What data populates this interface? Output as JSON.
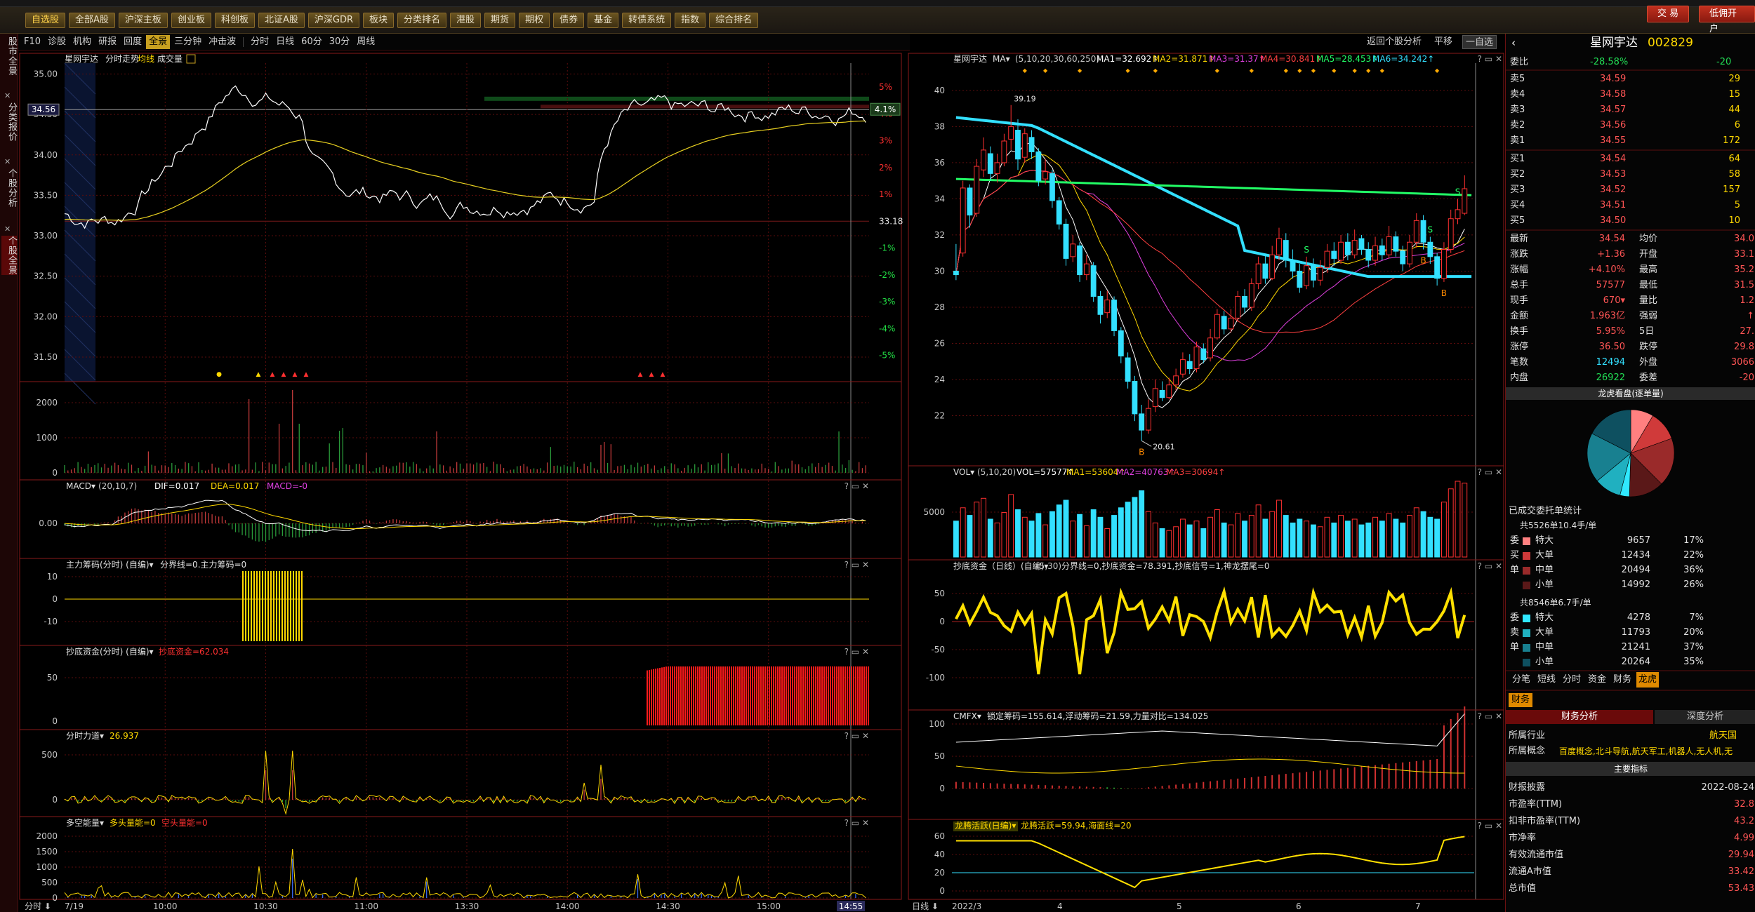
{
  "window": {
    "title": "星网宇达 002829"
  },
  "toolbar": {
    "buttons": [
      "自选股",
      "全部A股",
      "沪深主板",
      "创业板",
      "科创板",
      "北证A股",
      "沪深GDR",
      "板块",
      "分类排名",
      "港股",
      "期货",
      "期权",
      "债券",
      "基金",
      "转债系统",
      "指数",
      "综合排名"
    ],
    "trade_label": "交 易",
    "open_account_label": "低佣开户"
  },
  "sidebar": {
    "tabs": [
      "股市全景",
      "分类报价",
      "个股分析",
      "个股全景"
    ]
  },
  "subbar": {
    "items": [
      "F10",
      "诊股",
      "机构",
      "研报",
      "回度",
      "全景",
      "三分钟",
      "冲击波",
      "分时",
      "日线",
      "60分",
      "30分",
      "周线"
    ],
    "active": "全景"
  },
  "midbar": {
    "items": [
      "返回个股分析",
      "平移",
      "一自选"
    ]
  },
  "intraday": {
    "title": "星网宇达",
    "subtitle": "分时走势",
    "ma_label": "均线",
    "vol_label": "成交量",
    "price_axis": [
      "35.00",
      "34.50",
      "34.00",
      "33.50",
      "33.00",
      "32.50",
      "32.00",
      "31.50"
    ],
    "pct_axis": [
      "5%",
      "4%",
      "3%",
      "2%",
      "1%",
      "-1%",
      "-2%",
      "-3%",
      "-4%",
      "-5%"
    ],
    "prev_close": "33.18",
    "cur_price": "34.56",
    "cur_pct": "4.1%",
    "vol_axis": [
      "2000",
      "1000",
      "0"
    ],
    "time_labels": [
      "7/19",
      "10:00",
      "10:30",
      "11:00",
      "13:30",
      "14:00",
      "14:30",
      "15:00"
    ],
    "time_cur": "14:55",
    "x_label": "分时",
    "macd_title": "MACD",
    "macd_params": "(20,10,7)",
    "macd_dif": "DIF=0.017",
    "macd_dea": "DEA=0.017",
    "macd_val": "MACD=-0",
    "macd_axis": [
      "0.00"
    ],
    "zlcm_title": "主力筹码(分时)",
    "zlcm_text": "分界线=0.主力筹码=0",
    "zlcm_axis": [
      "10",
      "0",
      "-10"
    ],
    "cdzj_title": "抄底资金(分时)",
    "cdzj_text": "抄底资金=62.034",
    "cdzj_axis": [
      "50",
      "0"
    ],
    "fsld_title": "分时力道",
    "fsld_text": "26.937",
    "fsld_axis": [
      "500",
      "0"
    ],
    "dkn_title": "多空能量",
    "dkn_text1": "多头量能=0",
    "dkn_text2": "空头量能=0",
    "dkn_axis": [
      "2000",
      "1500",
      "1000",
      "500",
      "0"
    ],
    "panel_ctrl": "? ▭ ✕"
  },
  "daily": {
    "title": "星网宇达",
    "ma_label": "MA",
    "ma_params": "(5,10,20,30,60,250)",
    "ma_values": [
      "MA1=32.692",
      "MA2=31.871",
      "MA3=31.37",
      "MA4=30.841",
      "MA5=28.453",
      "MA6=34.242"
    ],
    "price_axis": [
      "40",
      "38",
      "36",
      "34",
      "32",
      "30",
      "28",
      "26",
      "24",
      "22"
    ],
    "high_mark": "39.19",
    "low_mark": "20.61",
    "vol_title": "VOL",
    "vol_params": "(5,10,20)",
    "vol_values": [
      "VOL=57577",
      "MA1=53604",
      "MA2=40763",
      "MA3=30694"
    ],
    "vol_axis": [
      "5000"
    ],
    "cdzj_title": "抄底资金（日线）",
    "cdzj_params": "(5,30)",
    "cdzj_text": "分界线=0,抄底资金=78.391,抄底信号=1,神龙摆尾=0",
    "cdzj_axis": [
      "50",
      "0",
      "-50",
      "-100"
    ],
    "cmfx_title": "CMFX",
    "cmfx_text": "锁定筹码=155.614,浮动筹码=21.59,力量对比=134.025",
    "cmfx_axis": [
      "100",
      "50",
      "0"
    ],
    "lthy_title": "龙腾活跃(日编)",
    "lthy_text": "龙腾活跃=59.94,海面线=20",
    "lthy_axis": [
      "60",
      "40",
      "20",
      "0"
    ],
    "x_label": "日线",
    "months": [
      "2022/3",
      "4",
      "5",
      "6",
      "7"
    ],
    "candles": [
      [
        30,
        29.8,
        31.5,
        29.5
      ],
      [
        31,
        34.6,
        35.0,
        30.8
      ],
      [
        34.6,
        33.1,
        34.8,
        32.4
      ],
      [
        33.2,
        35.8,
        36.2,
        33.0
      ],
      [
        35.6,
        36.7,
        37.4,
        35.2
      ],
      [
        36.5,
        35.4,
        36.9,
        35.0
      ],
      [
        35.4,
        36.0,
        36.5,
        34.9
      ],
      [
        36.0,
        37.2,
        37.6,
        35.8
      ],
      [
        37.3,
        38.0,
        39.19,
        36.7
      ],
      [
        37.8,
        36.2,
        38.4,
        35.6
      ],
      [
        36.3,
        37.6,
        37.9,
        36.0
      ],
      [
        37.4,
        36.6,
        37.8,
        36.2
      ],
      [
        36.6,
        35.0,
        36.8,
        34.7
      ],
      [
        35.1,
        35.5,
        36.2,
        34.8
      ],
      [
        35.4,
        33.9,
        35.6,
        33.5
      ],
      [
        33.9,
        32.6,
        34.1,
        32.3
      ],
      [
        32.6,
        30.7,
        32.9,
        30.3
      ],
      [
        30.8,
        31.5,
        32.0,
        30.5
      ],
      [
        31.4,
        29.8,
        31.6,
        29.4
      ],
      [
        29.8,
        30.4,
        30.9,
        29.5
      ],
      [
        30.3,
        28.6,
        30.5,
        28.3
      ],
      [
        28.6,
        27.6,
        28.9,
        27.1
      ],
      [
        27.7,
        28.4,
        28.9,
        27.4
      ],
      [
        28.4,
        26.7,
        28.6,
        26.4
      ],
      [
        26.7,
        25.3,
        26.9,
        24.9
      ],
      [
        25.2,
        23.9,
        25.5,
        23.5
      ],
      [
        23.9,
        22.1,
        24.2,
        21.7
      ],
      [
        22.1,
        21.2,
        22.6,
        20.61
      ],
      [
        21.2,
        22.4,
        22.9,
        21.0
      ],
      [
        22.5,
        23.5,
        24.0,
        22.2
      ],
      [
        23.4,
        23.0,
        23.9,
        22.8
      ],
      [
        23.0,
        23.7,
        24.1,
        22.9
      ],
      [
        23.7,
        24.2,
        24.6,
        23.4
      ],
      [
        24.3,
        25.1,
        25.5,
        24.1
      ],
      [
        25.0,
        24.6,
        25.4,
        24.3
      ],
      [
        24.6,
        25.8,
        26.1,
        24.4
      ],
      [
        25.7,
        25.1,
        26.0,
        24.9
      ],
      [
        25.2,
        26.3,
        26.8,
        25.0
      ],
      [
        26.3,
        27.6,
        27.9,
        26.2
      ],
      [
        27.5,
        26.8,
        27.8,
        26.5
      ],
      [
        26.8,
        27.4,
        27.9,
        26.6
      ],
      [
        27.4,
        28.6,
        28.9,
        27.2
      ],
      [
        28.6,
        28.0,
        29.0,
        27.7
      ],
      [
        28.0,
        29.3,
        29.6,
        27.8
      ],
      [
        29.3,
        30.4,
        30.8,
        29.0
      ],
      [
        30.4,
        29.6,
        30.9,
        29.3
      ],
      [
        29.6,
        30.9,
        31.4,
        29.5
      ],
      [
        30.9,
        31.8,
        32.4,
        30.6
      ],
      [
        31.7,
        30.6,
        32.1,
        30.2
      ],
      [
        30.6,
        30.0,
        31.2,
        29.6
      ],
      [
        30.0,
        29.1,
        30.4,
        28.8
      ],
      [
        29.2,
        30.3,
        30.8,
        29.0
      ],
      [
        30.3,
        29.5,
        30.7,
        29.1
      ],
      [
        29.5,
        30.2,
        30.6,
        29.2
      ],
      [
        30.2,
        31.1,
        31.5,
        29.9
      ],
      [
        31.1,
        30.7,
        31.6,
        30.3
      ],
      [
        30.6,
        31.6,
        32.0,
        30.4
      ],
      [
        31.6,
        30.9,
        32.1,
        30.6
      ],
      [
        30.9,
        31.7,
        32.3,
        30.7
      ],
      [
        31.8,
        31.2,
        32.0,
        30.9
      ],
      [
        31.2,
        30.6,
        31.6,
        30.2
      ],
      [
        30.6,
        31.4,
        31.9,
        30.3
      ],
      [
        31.4,
        30.9,
        31.8,
        30.6
      ],
      [
        30.9,
        31.9,
        32.5,
        30.7
      ],
      [
        31.9,
        31.1,
        32.2,
        30.8
      ],
      [
        31.1,
        30.4,
        31.4,
        30.0
      ],
      [
        30.4,
        31.6,
        32.0,
        30.2
      ],
      [
        31.6,
        32.8,
        33.2,
        31.3
      ],
      [
        32.8,
        31.6,
        33.1,
        31.2
      ],
      [
        31.6,
        30.8,
        31.9,
        30.4
      ],
      [
        30.8,
        29.6,
        31.0,
        29.2
      ],
      [
        29.6,
        31.2,
        31.6,
        29.4
      ],
      [
        31.2,
        32.9,
        33.4,
        31.0
      ],
      [
        32.9,
        33.4,
        34.0,
        32.6
      ],
      [
        33.2,
        34.56,
        35.3,
        33.1
      ]
    ],
    "volumes": [
      38,
      52,
      44,
      58,
      62,
      40,
      36,
      47,
      66,
      50,
      42,
      38,
      46,
      34,
      48,
      55,
      60,
      38,
      45,
      33,
      50,
      42,
      30,
      44,
      52,
      58,
      63,
      70,
      48,
      36,
      30,
      28,
      32,
      40,
      34,
      38,
      30,
      42,
      50,
      36,
      34,
      46,
      38,
      44,
      55,
      40,
      48,
      60,
      44,
      36,
      40,
      38,
      34,
      32,
      42,
      36,
      44,
      38,
      40,
      34,
      36,
      42,
      38,
      46,
      40,
      36,
      44,
      52,
      48,
      42,
      40,
      58,
      72,
      80,
      78
    ]
  },
  "right": {
    "stock_name": "星网宇达",
    "stock_code": "002829",
    "weibi_label": "委比",
    "weibi": "-28.58%",
    "weicha": "-20",
    "asks": [
      [
        "卖5",
        "34.59",
        "29"
      ],
      [
        "卖4",
        "34.58",
        "15"
      ],
      [
        "卖3",
        "34.57",
        "44"
      ],
      [
        "卖2",
        "34.56",
        "6"
      ],
      [
        "卖1",
        "34.55",
        "172"
      ]
    ],
    "bids": [
      [
        "买1",
        "34.54",
        "64"
      ],
      [
        "买2",
        "34.53",
        "58"
      ],
      [
        "买3",
        "34.52",
        "157"
      ],
      [
        "买4",
        "34.51",
        "5"
      ],
      [
        "买5",
        "34.50",
        "10"
      ]
    ],
    "quotes": [
      [
        "最新",
        "34.54",
        "均价",
        "34.0"
      ],
      [
        "涨跌",
        "+1.36",
        "开盘",
        "33.1"
      ],
      [
        "涨幅",
        "+4.10%",
        "最高",
        "35.2"
      ],
      [
        "总手",
        "57577",
        "最低",
        "31.5"
      ],
      [
        "现手",
        "670▾",
        "量比",
        "1.2"
      ],
      [
        "金额",
        "1.963亿",
        "强弱",
        "↑"
      ],
      [
        "换手",
        "5.95%",
        "5日",
        "27."
      ],
      [
        "涨停",
        "36.50",
        "跌停",
        "29.8"
      ],
      [
        "笔数",
        "12494",
        "外盘",
        "3066"
      ],
      [
        "内盘",
        "26922",
        "委差",
        "-20"
      ]
    ],
    "pie_title": "龙虎看盘(逐单量)",
    "trade_title": "已成交委托单统计",
    "buy_total": "共5526单10.4手/单",
    "sell_total": "共8546单6.7手/单",
    "buy_side": [
      "委",
      "买",
      "单"
    ],
    "sell_side": [
      "委",
      "卖",
      "单"
    ],
    "buy_stats": [
      [
        "特大",
        "9657",
        "17%"
      ],
      [
        "大单",
        "12434",
        "22%"
      ],
      [
        "中单",
        "20494",
        "36%"
      ],
      [
        "小单",
        "14992",
        "26%"
      ]
    ],
    "sell_stats": [
      [
        "特大",
        "4278",
        "7%"
      ],
      [
        "大单",
        "11793",
        "20%"
      ],
      [
        "中单",
        "21241",
        "37%"
      ],
      [
        "小单",
        "20264",
        "35%"
      ]
    ],
    "pie_colors": [
      "#ff8080",
      "#d03a3a",
      "#9a2a2a",
      "#5a1818",
      "#30e8ff",
      "#20b0c0",
      "#188090",
      "#0e5060"
    ],
    "tabs": [
      "分笔",
      "短线",
      "分时",
      "资金",
      "财务",
      "龙虎"
    ],
    "active_tab": "龙虎",
    "fin_tab": "财务",
    "fin_sub": [
      "财务分析",
      "深度分析"
    ],
    "industry_label": "所属行业",
    "industry": "航天国",
    "concept_label": "所属概念",
    "concept": "百度概念,北斗导航,航天军工,机器人,无人机,无",
    "main_title": "主要指标",
    "fin_rows": [
      [
        "财报披露",
        "2022-08-24"
      ],
      [
        "市盈率(TTM)",
        "32.8"
      ],
      [
        "扣非市盈率(TTM)",
        "43.2"
      ],
      [
        "市净率",
        "4.99"
      ],
      [
        "有效流通市值",
        "29.94"
      ],
      [
        "流通A市值",
        "33.42"
      ],
      [
        "总市值",
        "53.43"
      ]
    ]
  }
}
